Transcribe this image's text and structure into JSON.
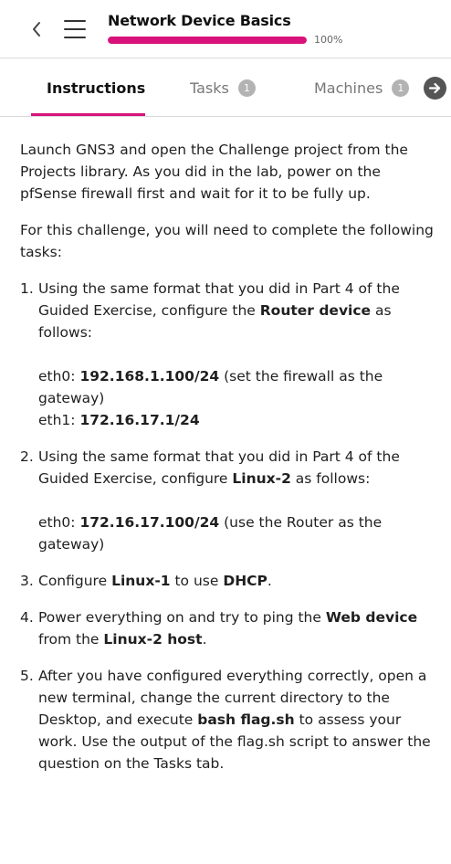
{
  "header": {
    "title": "Network Device Basics",
    "progress_label": "100%",
    "progress_value": 1.0,
    "accent_color": "#d8127a"
  },
  "tabs": [
    {
      "label": "Instructions",
      "badge": ""
    },
    {
      "label": "Tasks",
      "badge": "1"
    },
    {
      "label": "Machines",
      "badge": "1"
    }
  ],
  "icons": {
    "back": "chevron-left-icon",
    "menu": "hamburger-menu-icon",
    "next": "arrow-right-circle-icon"
  },
  "content": {
    "intro": "Launch GNS3 and open the Challenge project from the Projects library. As you did in the lab, power on the pfSense firewall first and wait for it to be fully up.",
    "tasks_intro": "For this challenge, you will need to complete the following tasks:",
    "steps": [
      {
        "number": "1.",
        "p1": "Using the same format that you did in Part 4 of the Guided Exercise, configure the ",
        "b1": "Router device",
        "p2": " as follows:",
        "line1_prefix": "eth0: ",
        "line1_value": "192.168.1.100/24",
        "line1_note": " (set the firewall as the gateway)",
        "line2_prefix": "eth1: ",
        "line2_value": "172.16.17.1/24"
      },
      {
        "number": "2.",
        "p1": "Using the same format that you did in Part 4 of the Guided Exercise, configure ",
        "b1": "Linux-2",
        "p2": " as follows:",
        "line1_prefix": "eth0: ",
        "line1_value": "172.16.17.100/24",
        "line1_note": " (use the Router as the gateway)"
      },
      {
        "number": "3.",
        "p1": "Configure ",
        "b1": "Linux-1",
        "p2": " to use ",
        "b2": "DHCP",
        "p3": "."
      },
      {
        "number": "4.",
        "p1": "Power everything on and try to ping the ",
        "b1": "Web device",
        "p2": " from the ",
        "b2": "Linux-2 host",
        "p3": "."
      },
      {
        "number": "5.",
        "p1": "After you have configured everything correctly, open a new terminal, change the current directory to the Desktop, and execute ",
        "b1": "bash flag.sh",
        "p2": " to assess your work. Use the output of the flag.sh script to answer the question on the Tasks tab."
      }
    ]
  }
}
